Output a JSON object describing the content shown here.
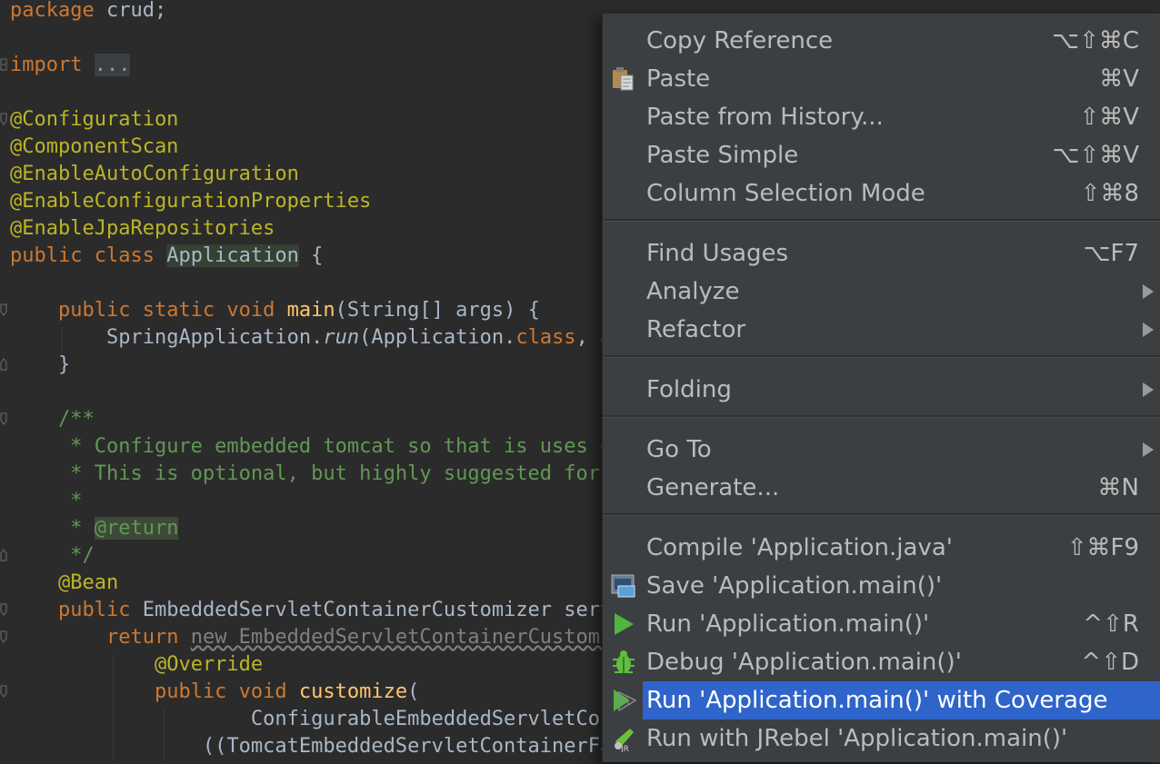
{
  "editor": {
    "line1": {
      "kw": "package",
      "rest": " crud;"
    },
    "line2": {
      "kw": "import",
      "fold": "..."
    },
    "ann1": "@Configuration",
    "ann2": "@ComponentScan",
    "ann3": "@EnableAutoConfiguration",
    "ann4": "@EnableConfigurationProperties",
    "ann5": "@EnableJpaRepositories",
    "class_decl": {
      "kw": "public class",
      "name": "Application",
      "rest": " {"
    },
    "main_decl": {
      "kw": "public static void",
      "name": "main",
      "rest": "(String[] args) {"
    },
    "run_call": {
      "pre": "SpringApplication.",
      "run": "run",
      "mid": "(Application.",
      "cls": "class",
      "rest": ", args);"
    },
    "close1": "}",
    "doc1": "/**",
    "doc2": " * Configure embedded tomcat so that is uses gzip for static resources.",
    "doc3": " * This is optional, but highly suggested for better startup time.",
    "doc4": " *",
    "doc5_pre": " * ",
    "doc5_tag": "@return",
    "doc6": " */",
    "bean": "@Bean",
    "cust_decl": {
      "kw": "public",
      "rest": " EmbeddedServletContainerCustomizer servletContainerCustomizer() {"
    },
    "ret": {
      "kw": "return",
      "sp": " ",
      "new": "new EmbeddedServletContainerCustomizer() {"
    },
    "override": "@Override",
    "customize": {
      "kw": "public void",
      "name": "customize",
      "rest": "("
    },
    "param": "ConfigurableEmbeddedServletContainer servletContainer) {",
    "cast": "((TomcatEmbeddedServletContainerFactory) servletContainer)"
  },
  "context_menu": {
    "items": [
      {
        "label": "Copy Reference",
        "shortcut": "⌥⇧⌘C"
      },
      {
        "label": "Paste",
        "shortcut": "⌘V",
        "icon": "clipboard-icon"
      },
      {
        "label": "Paste from History...",
        "shortcut": "⇧⌘V"
      },
      {
        "label": "Paste Simple",
        "shortcut": "⌥⇧⌘V"
      },
      {
        "label": "Column Selection Mode",
        "shortcut": "⇧⌘8"
      },
      {
        "label": "Find Usages",
        "shortcut": "⌥F7"
      },
      {
        "label": "Analyze",
        "submenu": true
      },
      {
        "label": "Refactor",
        "submenu": true
      },
      {
        "label": "Folding",
        "submenu": true
      },
      {
        "label": "Go To",
        "submenu": true
      },
      {
        "label": "Generate...",
        "shortcut": "⌘N"
      },
      {
        "label": "Compile 'Application.java'",
        "shortcut": "⇧⌘F9"
      },
      {
        "label": "Save 'Application.main()'",
        "icon": "save-config-icon"
      },
      {
        "label": "Run 'Application.main()'",
        "shortcut": "^⇧R",
        "icon": "run-icon"
      },
      {
        "label": "Debug 'Application.main()'",
        "shortcut": "^⇧D",
        "icon": "debug-icon"
      },
      {
        "label": "Run 'Application.main()' with Coverage",
        "icon": "coverage-icon",
        "selected": true
      },
      {
        "label": "Run with JRebel 'Application.main()'",
        "icon": "jrebel-icon"
      }
    ]
  },
  "colors": {
    "editor_bg": "#2b2b2b",
    "menu_bg": "#3c3f41",
    "selection": "#2f65ca",
    "keyword": "#cc7832",
    "annotation": "#bbb529",
    "function": "#ffc66d",
    "doc_comment": "#629755"
  }
}
